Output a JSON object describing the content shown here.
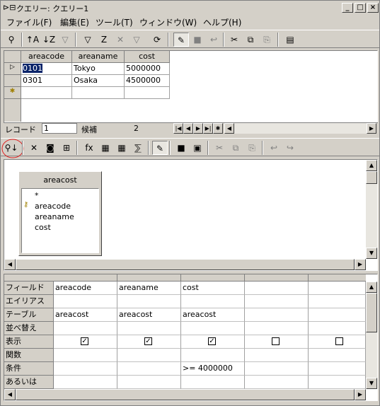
{
  "window": {
    "title": "クエリー: クエリー1",
    "minimize": "_",
    "maximize": "□",
    "close": "×"
  },
  "menu": [
    "ファイル(F)",
    "編集(E)",
    "ツール(T)",
    "ウィンドウ(W)",
    "ヘルプ(H)"
  ],
  "datasheet": {
    "columns": [
      "areacode",
      "areaname",
      "cost"
    ],
    "rows": [
      [
        "0101",
        "Tokyo",
        "5000000"
      ],
      [
        "0301",
        "Osaka",
        "4500000"
      ]
    ],
    "new_row_marker": "✱",
    "current_marker": "▷"
  },
  "record_nav": {
    "label": "レコード",
    "current": "1",
    "candidates_label": "候補",
    "count": "2"
  },
  "field_list": {
    "title": "areacost",
    "fields": [
      "*",
      "areacode",
      "areaname",
      "cost"
    ],
    "primary_key": "areacode"
  },
  "grid": {
    "row_labels": [
      "フィールド",
      "エイリアス",
      "テーブル",
      "並べ替え",
      "表示",
      "関数",
      "条件",
      "あるいは"
    ],
    "columns": [
      {
        "field": "areacode",
        "alias": "",
        "table": "areacost",
        "sort": "",
        "show": true,
        "function": "",
        "criteria": "",
        "or": ""
      },
      {
        "field": "areaname",
        "alias": "",
        "table": "areacost",
        "sort": "",
        "show": true,
        "function": "",
        "criteria": "",
        "or": ""
      },
      {
        "field": "cost",
        "alias": "",
        "table": "areacost",
        "sort": "",
        "show": true,
        "function": "",
        "criteria": ">= 4000000",
        "or": ""
      },
      {
        "field": "",
        "alias": "",
        "table": "",
        "sort": "",
        "show": false,
        "function": "",
        "criteria": "",
        "or": ""
      },
      {
        "field": "",
        "alias": "",
        "table": "",
        "sort": "",
        "show": false,
        "function": "",
        "criteria": "",
        "or": ""
      }
    ]
  },
  "colors": {
    "face": "#d4d0c8",
    "highlight_circle": "#e02020",
    "selection": "#0a246a"
  }
}
